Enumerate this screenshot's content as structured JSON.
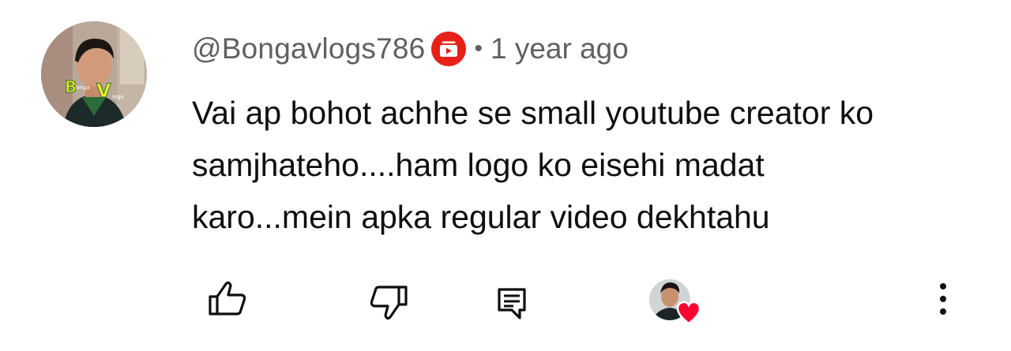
{
  "comment": {
    "author_handle": "@Bongavlogs786",
    "separator": "•",
    "timestamp": "1 year ago",
    "text_lines": [
      "Vai ap bohot achhe se small youtube creator ko",
      "samjhateho....ham logo ko eisehi madat",
      "karo...mein apka regular video dekhtahu"
    ],
    "avatar_text": "BongaVlogs"
  },
  "icons": {
    "badge": "creator-badge-icon",
    "like": "thumbs-up-icon",
    "dislike": "thumbs-down-icon",
    "reply": "reply-comment-icon",
    "creator_heart": "heart-icon",
    "more": "more-vertical-icon"
  },
  "colors": {
    "badge_red": "#e62117",
    "heart_red": "#ff0033",
    "meta_gray": "#606060",
    "text_black": "#0f0f0f"
  }
}
